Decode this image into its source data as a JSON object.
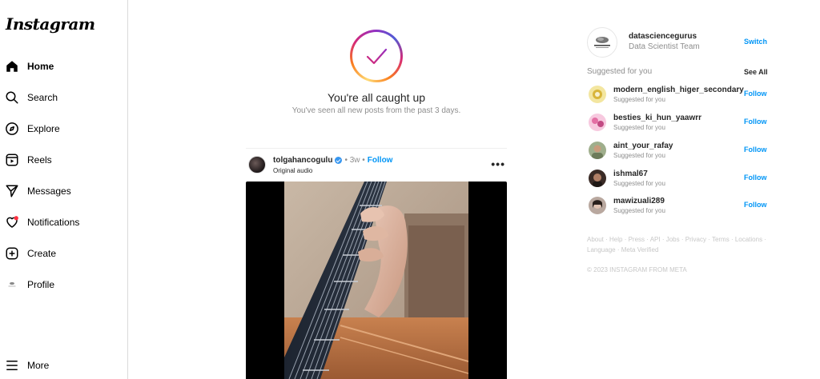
{
  "app": {
    "logo_text": "Instagram"
  },
  "sidebar": {
    "items": [
      {
        "label": "Home",
        "icon": "home-icon"
      },
      {
        "label": "Search",
        "icon": "search-icon"
      },
      {
        "label": "Explore",
        "icon": "compass-icon"
      },
      {
        "label": "Reels",
        "icon": "reels-icon"
      },
      {
        "label": "Messages",
        "icon": "send-icon"
      },
      {
        "label": "Notifications",
        "icon": "heart-icon"
      },
      {
        "label": "Create",
        "icon": "plus-square-icon"
      },
      {
        "label": "Profile",
        "icon": "profile-avatar-icon"
      },
      {
        "label": "More",
        "icon": "menu-icon"
      }
    ]
  },
  "feed": {
    "caught_title": "You're all caught up",
    "caught_sub": "You've seen all new posts from the past 3 days.",
    "post": {
      "username": "tolgahancogulu",
      "age": "• 3w •",
      "follow": "Follow",
      "audio": "Original audio",
      "more": "•••"
    }
  },
  "right": {
    "me": {
      "username": "datasciencegurus",
      "fullname": "Data Scientist Team",
      "switch": "Switch"
    },
    "suggested_title": "Suggested for you",
    "see_all": "See All",
    "suggestions": [
      {
        "username": "modern_english_higer_secondary",
        "sub": "Suggested for you",
        "follow": "Follow"
      },
      {
        "username": "besties_ki_hun_yaawrr",
        "sub": "Suggested for you",
        "follow": "Follow"
      },
      {
        "username": "aint_your_rafay",
        "sub": "Suggested for you",
        "follow": "Follow"
      },
      {
        "username": "ishmal67",
        "sub": "Suggested for you",
        "follow": "Follow"
      },
      {
        "username": "mawizuali289",
        "sub": "Suggested for you",
        "follow": "Follow"
      }
    ],
    "footer_line1": [
      "About",
      "Help",
      "Press",
      "API",
      "Jobs",
      "Privacy",
      "Terms",
      "Locations"
    ],
    "footer_line2": [
      "Language",
      "Meta Verified"
    ],
    "copyright": "© 2023 INSTAGRAM FROM META"
  },
  "colors": {
    "link_blue": "#0095f6",
    "notification_dot": "#ff3040"
  }
}
